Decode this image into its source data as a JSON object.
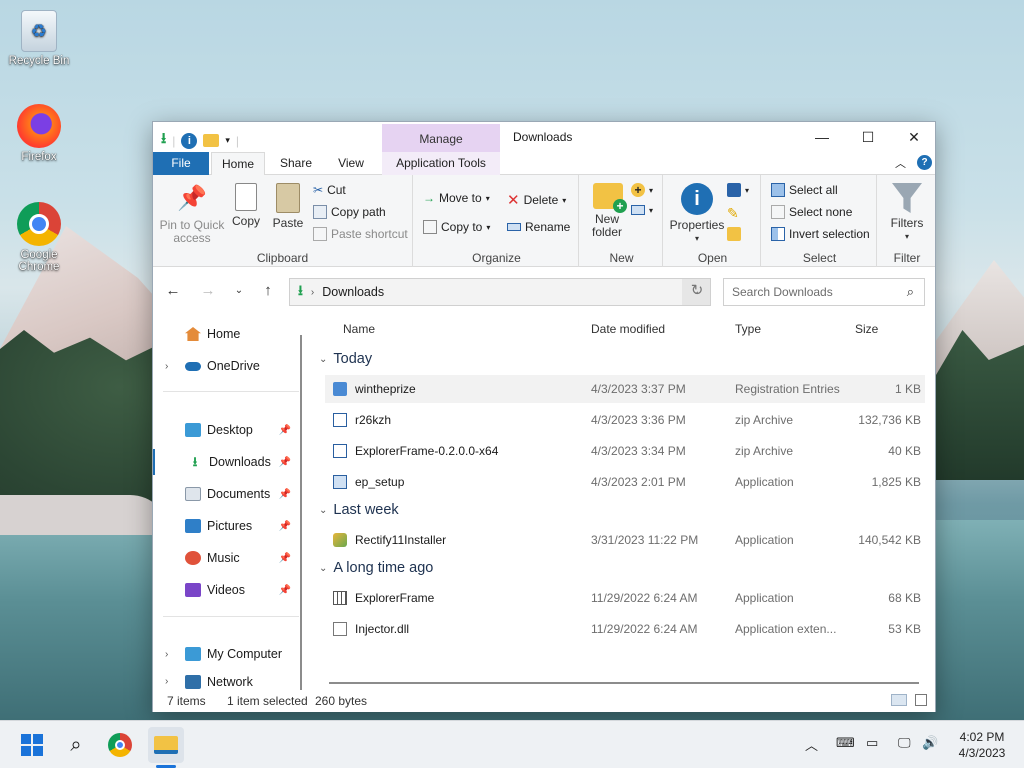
{
  "desktop": {
    "icons": [
      {
        "label": "Recycle Bin"
      },
      {
        "label": "Firefox"
      },
      {
        "label": "Google Chrome"
      }
    ]
  },
  "window": {
    "title": "Downloads",
    "manage_label": "Manage",
    "tabs": {
      "file": "File",
      "home": "Home",
      "share": "Share",
      "view": "View",
      "apptools": "Application Tools"
    }
  },
  "ribbon": {
    "clipboard": {
      "label": "Clipboard",
      "pin": "Pin to Quick access",
      "copy": "Copy",
      "paste": "Paste",
      "cut": "Cut",
      "copy_path": "Copy path",
      "paste_shortcut": "Paste shortcut"
    },
    "organize": {
      "label": "Organize",
      "move_to": "Move to",
      "copy_to": "Copy to",
      "delete": "Delete",
      "rename": "Rename"
    },
    "new": {
      "label": "New",
      "new_folder": "New folder"
    },
    "open": {
      "label": "Open",
      "properties": "Properties"
    },
    "select": {
      "label": "Select",
      "select_all": "Select all",
      "select_none": "Select none",
      "invert": "Invert selection"
    },
    "filter": {
      "label": "Filter",
      "filters": "Filters"
    }
  },
  "navbar": {
    "address": "Downloads",
    "search_placeholder": "Search Downloads"
  },
  "nav_pane": {
    "home": "Home",
    "onedrive": "OneDrive",
    "pinned": [
      "Desktop",
      "Downloads",
      "Documents",
      "Pictures",
      "Music",
      "Videos"
    ],
    "mycomputer": "My Computer",
    "network": "Network"
  },
  "columns": {
    "name": "Name",
    "date": "Date modified",
    "type": "Type",
    "size": "Size"
  },
  "groups": [
    {
      "title": "Today",
      "files": [
        {
          "name": "wintheprize",
          "date": "4/3/2023 3:37 PM",
          "type": "Registration Entries",
          "size": "1 KB"
        },
        {
          "name": "r26kzh",
          "date": "4/3/2023 3:36 PM",
          "type": "zip Archive",
          "size": "132,736 KB"
        },
        {
          "name": "ExplorerFrame-0.2.0.0-x64",
          "date": "4/3/2023 3:34 PM",
          "type": "zip Archive",
          "size": "40 KB"
        },
        {
          "name": "ep_setup",
          "date": "4/3/2023 2:01 PM",
          "type": "Application",
          "size": "1,825 KB"
        }
      ]
    },
    {
      "title": "Last week",
      "files": [
        {
          "name": "Rectify11Installer",
          "date": "3/31/2023 11:22 PM",
          "type": "Application",
          "size": "140,542 KB"
        }
      ]
    },
    {
      "title": "A long time ago",
      "files": [
        {
          "name": "ExplorerFrame",
          "date": "11/29/2022 6:24 AM",
          "type": "Application",
          "size": "68 KB"
        },
        {
          "name": "Injector.dll",
          "date": "11/29/2022 6:24 AM",
          "type": "Application exten...",
          "size": "53 KB"
        }
      ]
    }
  ],
  "status": {
    "items": "7 items",
    "selected": "1 item selected",
    "bytes": "260 bytes"
  },
  "taskbar": {
    "time": "4:02 PM",
    "date": "4/3/2023"
  },
  "colors": {
    "accent": "#1f6fb4",
    "manage_tab": "#e6d3f2",
    "selection": "#f2f2f2"
  }
}
